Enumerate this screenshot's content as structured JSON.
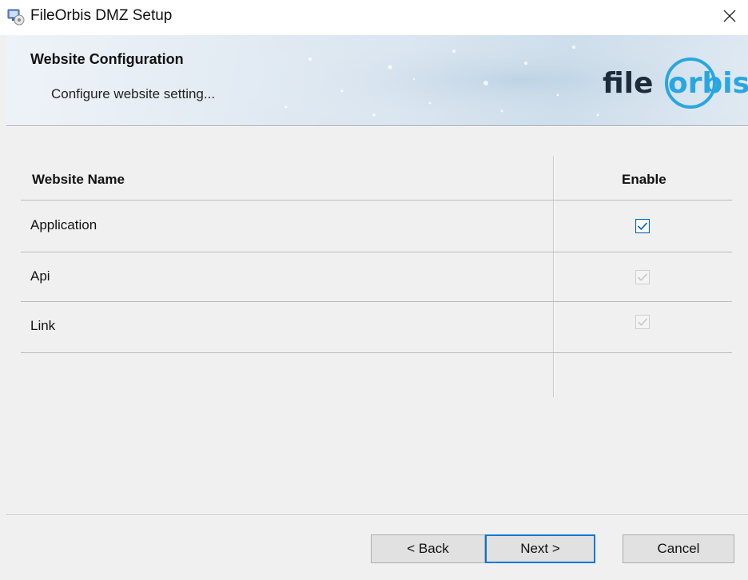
{
  "window": {
    "title": "FileOrbis DMZ Setup",
    "icon": "setup-icon",
    "close_label": "✕"
  },
  "banner": {
    "title": "Website Configuration",
    "subtitle": "Configure website setting...",
    "logo_text_left": "file",
    "logo_text_right": "rbis",
    "logo_color_dark": "#1c2a3a",
    "logo_color_accent": "#29a6df"
  },
  "table": {
    "headers": {
      "name": "Website Name",
      "enable": "Enable"
    },
    "rows": [
      {
        "name": "Application",
        "enabled": true,
        "editable": true
      },
      {
        "name": "Api",
        "enabled": true,
        "editable": false
      },
      {
        "name": "Link",
        "enabled": true,
        "editable": false
      }
    ]
  },
  "buttons": {
    "back": "< Back",
    "next": "Next >",
    "cancel": "Cancel"
  },
  "colors": {
    "accent": "#0078d7",
    "checkbox_active": "#0063b1",
    "checkbox_disabled": "#c4c4c4"
  }
}
